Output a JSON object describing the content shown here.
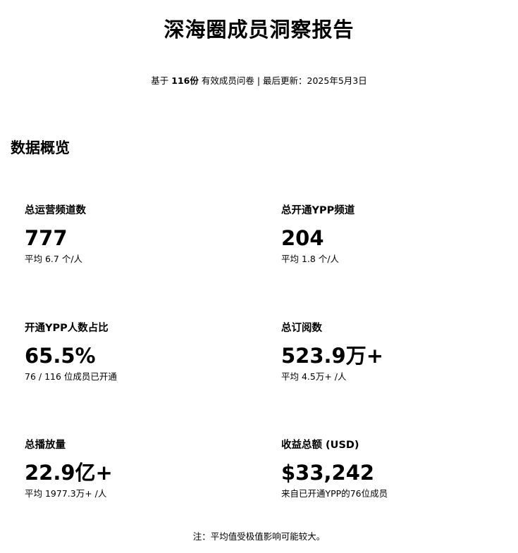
{
  "report": {
    "title": "深海圈成员洞察报告",
    "subtitle_prefix": "基于",
    "subtitle_count": "116份",
    "subtitle_rest": "有效成员问卷 | 最后更新：2025年5月3日"
  },
  "overview": {
    "section_title": "数据概览",
    "cards": [
      {
        "label": "总运营频道数",
        "value": "777",
        "sub": "平均 6.7 个/人"
      },
      {
        "label": "总开通YPP频道",
        "value": "204",
        "sub": "平均 1.8 个/人"
      },
      {
        "label": "开通YPP人数占比",
        "value": "65.5%",
        "sub": "76 / 116 位成员已开通"
      },
      {
        "label": "总订阅数",
        "value": "523.9万+",
        "sub": "平均 4.5万+ /人"
      },
      {
        "label": "总播放量",
        "value": "22.9亿+",
        "sub": "平均 1977.3万+ /人"
      },
      {
        "label": "收益总额 (USD)",
        "value": "$33,242",
        "sub": "来自已开通YPP的76位成员"
      }
    ]
  },
  "footnote": "注：平均值受极值影响可能较大。"
}
